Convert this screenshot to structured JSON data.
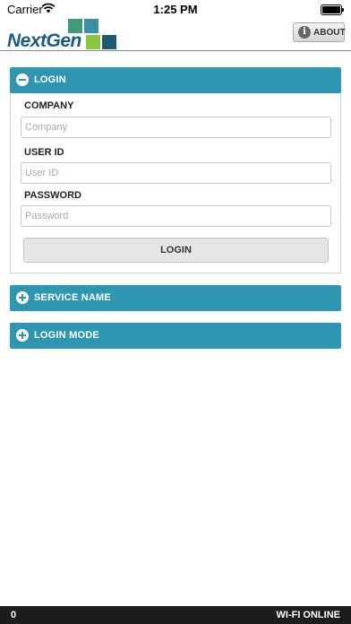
{
  "status_bar": {
    "carrier": "Carrier",
    "time": "1:25 PM"
  },
  "header": {
    "logo_text": "NextGen",
    "logo_colors": [
      "#3e9b7b",
      "#3d8fa6",
      "#8cc63f",
      "#2a6276",
      "#1f5a73"
    ],
    "about_label": "ABOUT",
    "about_icon": "info-icon"
  },
  "sections": {
    "login": {
      "title": "LOGIN",
      "expanded": true,
      "company_label": "COMPANY",
      "company_placeholder": "Company",
      "company_value": "",
      "userid_label": "USER ID",
      "userid_placeholder": "User ID",
      "userid_value": "",
      "password_label": "PASSWORD",
      "password_placeholder": "Password",
      "password_value": "",
      "button_label": "LOGIN"
    },
    "service_name": {
      "title": "SERVICE NAME",
      "expanded": false
    },
    "login_mode": {
      "title": "LOGIN MODE",
      "expanded": false
    }
  },
  "footer": {
    "left_text": "0",
    "right_text": "WI-FI ONLINE"
  },
  "colors": {
    "accent": "#2f96b1",
    "footer_bg": "#1d1d1d"
  }
}
